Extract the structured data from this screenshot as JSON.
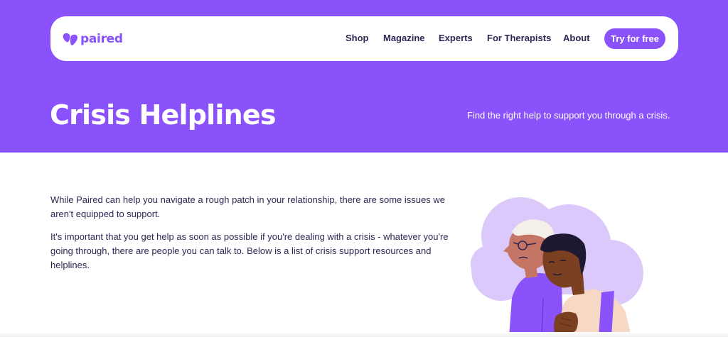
{
  "brand": {
    "name": "paired"
  },
  "nav": {
    "items": [
      {
        "label": "Shop"
      },
      {
        "label": "Magazine"
      },
      {
        "label": "Experts"
      },
      {
        "label": "For Therapists"
      },
      {
        "label": "About"
      }
    ],
    "cta_label": "Try for free"
  },
  "hero": {
    "title": "Crisis Helplines",
    "subtitle": "Find the right help to support you through a crisis."
  },
  "intro": {
    "paragraphs": [
      "While Paired can help you navigate a rough patch in your relationship, there are some issues we aren't equipped to support.",
      "It's important that you get help as soon as possible if you're dealing with a crisis - whatever you're going through, there are people you can talk to. Below is a list of crisis support resources and helplines."
    ]
  },
  "colors": {
    "brand_purple": "#8a52fb",
    "text_dark": "#2f2653",
    "cloud_lavender": "#dcc9fb",
    "white": "#ffffff"
  },
  "icons": [
    "heart-logo-icon"
  ]
}
